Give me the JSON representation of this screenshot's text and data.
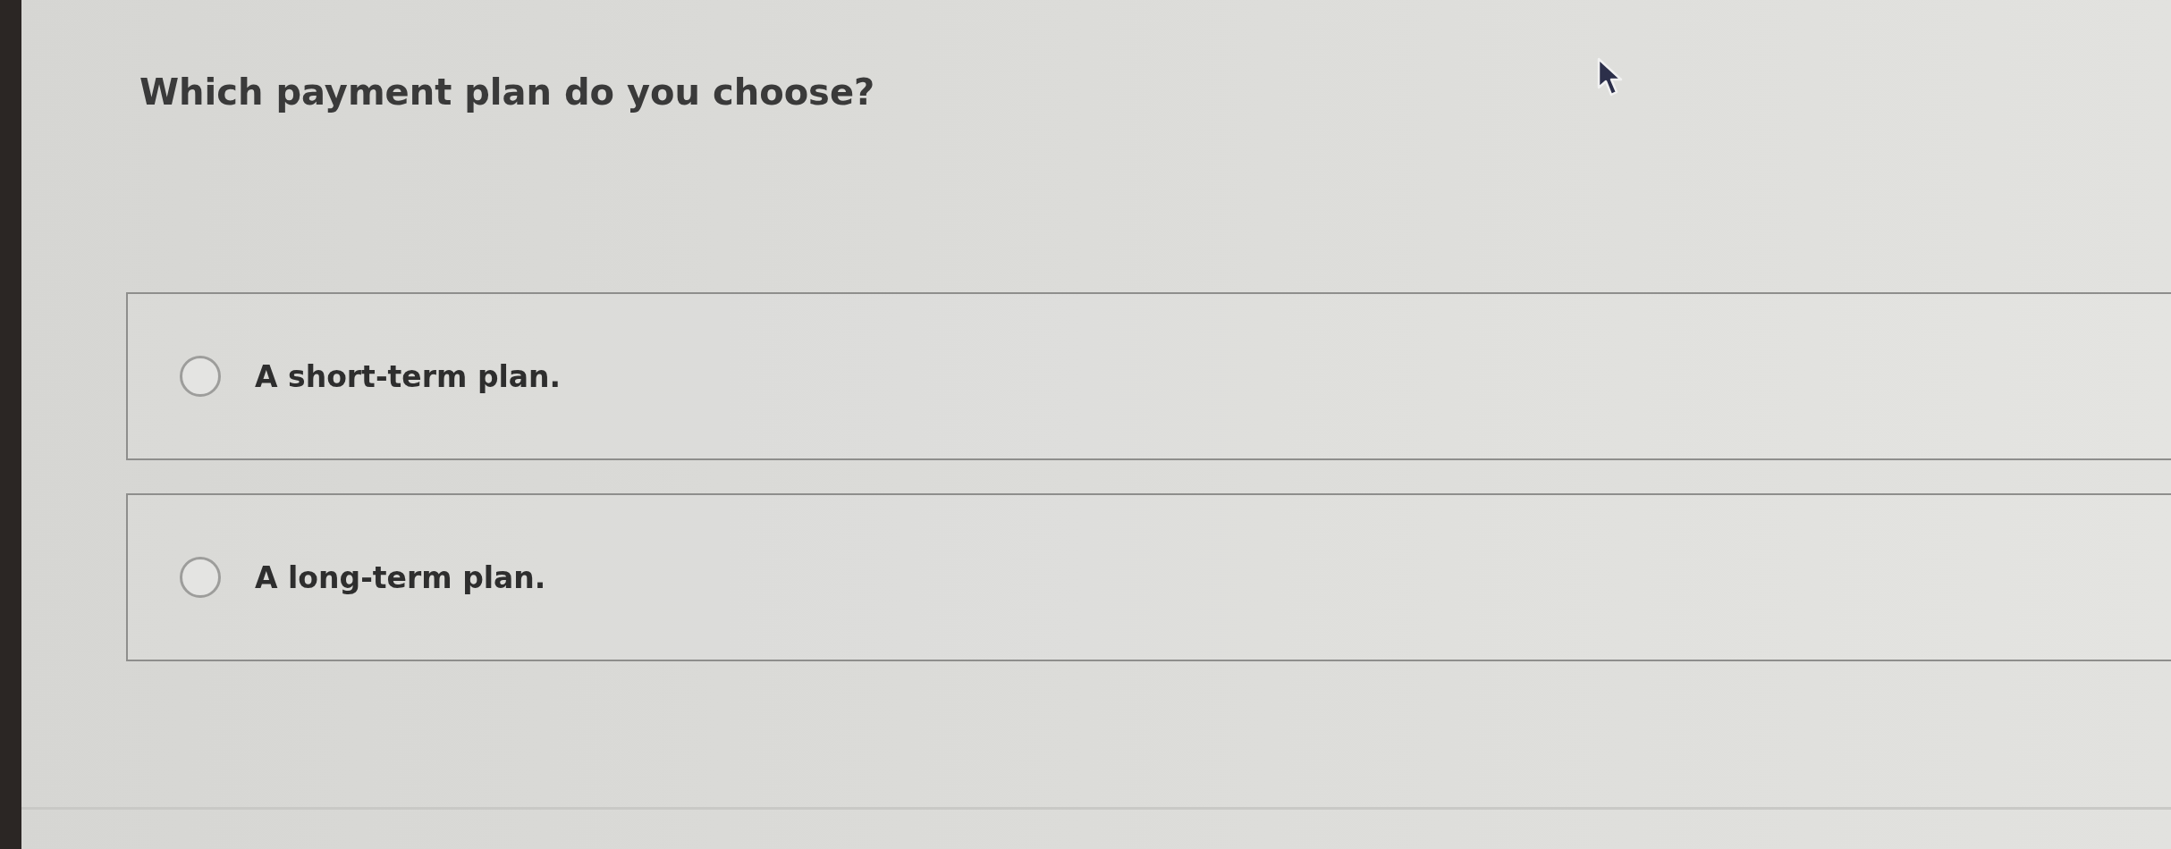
{
  "question": {
    "text": "Which payment plan do you choose?"
  },
  "options": [
    {
      "label": "A short-term plan.",
      "selected": false
    },
    {
      "label": "A long-term plan.",
      "selected": false
    }
  ]
}
